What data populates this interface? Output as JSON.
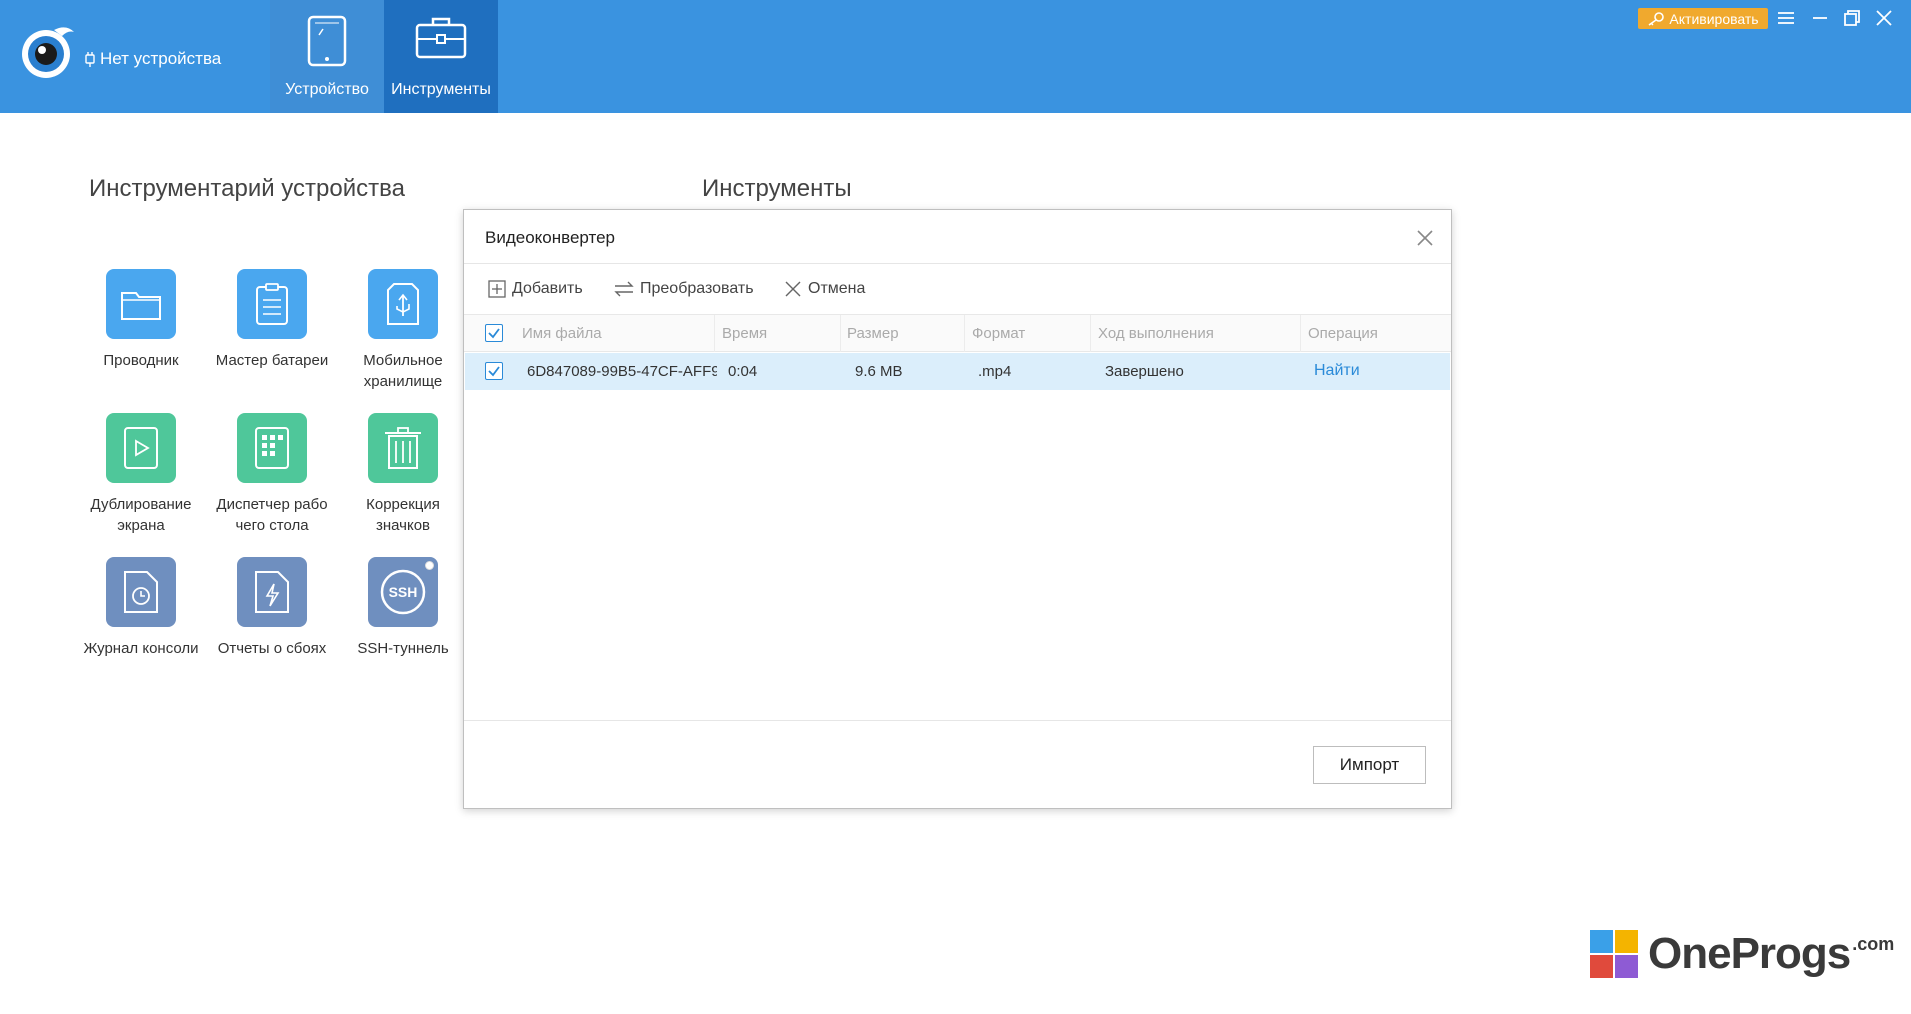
{
  "header": {
    "device_status": "Нет устройства",
    "tabs": [
      {
        "label": "Устройство"
      },
      {
        "label": "Инструменты"
      }
    ],
    "activate_label": "Активировать",
    "accent": "#3a93e0",
    "active_tab_color": "#1f6fbf",
    "activate_color": "#f0a92e"
  },
  "left_panel": {
    "title": "Инструментарий устройства",
    "tools": [
      {
        "label": "Проводник",
        "icon": "folder-icon",
        "color": "#4aa7ef"
      },
      {
        "label": "Мастер батареи",
        "icon": "clipboard-icon",
        "color": "#4aa7ef"
      },
      {
        "label": "Мобильное хранилище",
        "icon": "usb-drive-icon",
        "color": "#4aa7ef"
      },
      {
        "label": "Дублирование экрана",
        "icon": "play-icon",
        "color": "#4fc79a"
      },
      {
        "label": "Диспетчер рабо чего стола",
        "icon": "grid-icon",
        "color": "#4fc79a"
      },
      {
        "label": "Коррекция значков",
        "icon": "trash-icon",
        "color": "#4fc79a"
      },
      {
        "label": "Журнал консоли",
        "icon": "clock-file-icon",
        "color": "#6f8fbf"
      },
      {
        "label": "Отчеты о сбоях",
        "icon": "lightning-file-icon",
        "color": "#6f8fbf"
      },
      {
        "label": "SSH-туннель",
        "icon": "ssh-icon",
        "color": "#6f8fbf"
      }
    ]
  },
  "right_panel": {
    "title": "Инструменты"
  },
  "dialog": {
    "title": "Видеоконвертер",
    "toolbar": {
      "add": "Добавить",
      "convert": "Преобразовать",
      "cancel": "Отмена"
    },
    "columns": [
      "Имя файла",
      "Время",
      "Размер",
      "Формат",
      "Ход выполнения",
      "Операция"
    ],
    "rows": [
      {
        "checked": true,
        "filename": "6D847089-99B5-47CF-AFF9-",
        "time": "0:04",
        "size": "9.6 MB",
        "format": ".mp4",
        "progress": "Завершено",
        "operation": "Найти"
      }
    ],
    "import_label": "Импорт",
    "row_highlight": "#dbeefb",
    "link_color": "#2a8ad8"
  },
  "watermark": {
    "text": "OneProgs",
    "suffix": ".com"
  }
}
